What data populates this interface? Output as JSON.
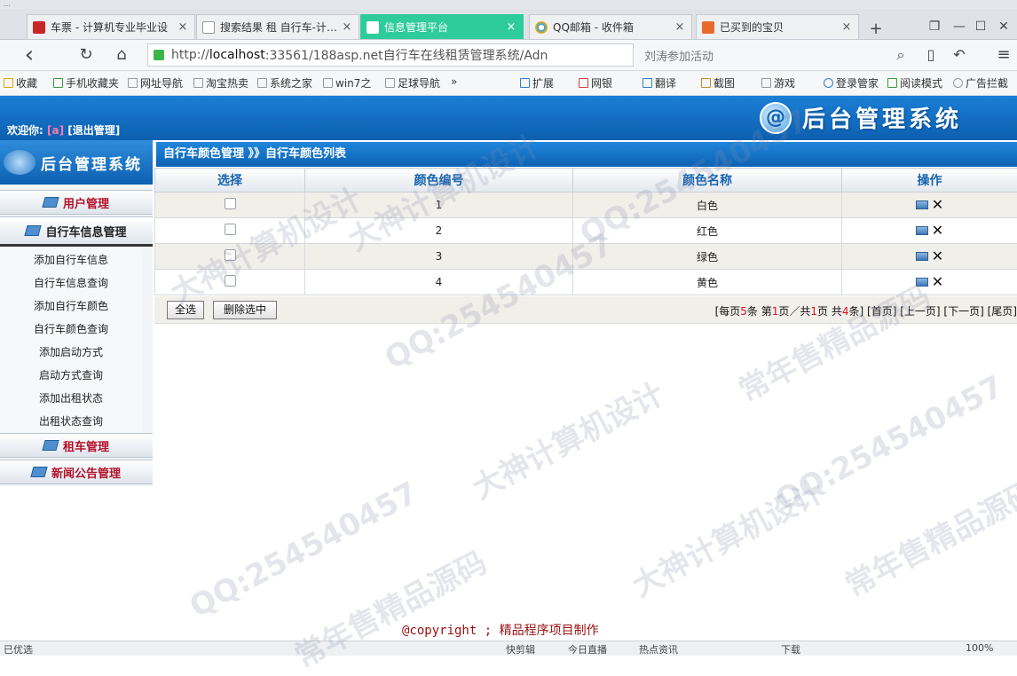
{
  "browser": {
    "top_strip_text": "…",
    "tabs": [
      {
        "label": "车票 - 计算机专业毕业设",
        "active": false,
        "icon_color": "#c62828"
      },
      {
        "label": "搜索结果 租 自行车-计…",
        "active": false,
        "icon_color": "#ffffff"
      },
      {
        "label": "信息管理平台",
        "active": true,
        "icon_color": "#ffffff"
      },
      {
        "label": "QQ邮箱 - 收件箱",
        "active": false,
        "icon_color": "#2e9cf0"
      },
      {
        "label": "已买到的宝贝",
        "active": false,
        "icon_color": "#e86a2a"
      }
    ],
    "tab_close": "×",
    "new_tab": "+",
    "window_controls": [
      "❐",
      "—",
      "☐",
      "✕"
    ],
    "nav": {
      "back": "‹",
      "refresh": "↻",
      "home": "⌂"
    },
    "url": {
      "prefix": "http://",
      "host": "localhost",
      "rest": ":33561/188asp.net自行车在线租赁管理系统/Adn"
    },
    "search_placeholder": "刘涛参加活动",
    "toolbar_right": [
      "⌕",
      "▯",
      "↶",
      "≡"
    ],
    "bookmarks": [
      "收藏",
      "手机收藏夹",
      "网址导航",
      "淘宝热卖",
      "系统之家",
      "win7之",
      "足球导航",
      "»",
      "扩展",
      "网银",
      "翻译",
      "截图",
      "游戏",
      "登录管家",
      "阅读模式",
      "广告拦截"
    ]
  },
  "header": {
    "welcome_label": "欢迎你:",
    "username": "[a]",
    "logout": "[退出管理]",
    "system_title": "后台管理系统",
    "logo_glyph": "@"
  },
  "sidebar": {
    "brand": "后台管理系统",
    "groups": [
      {
        "label": "用户管理"
      },
      {
        "label": "自行车信息管理"
      },
      {
        "label": "租车管理"
      },
      {
        "label": "新闻公告管理"
      }
    ],
    "items": [
      "添加自行车信息",
      "自行车信息查询",
      "添加自行车颜色",
      "自行车颜色查询",
      "添加启动方式",
      "启动方式查询",
      "添加出租状态",
      "出租状态查询"
    ]
  },
  "breadcrumb": "自行车颜色管理 》》自行车颜色列表",
  "table": {
    "headers": [
      "选择",
      "颜色编号",
      "颜色名称",
      "操作"
    ],
    "rows": [
      {
        "id": "1",
        "name": "白色"
      },
      {
        "id": "2",
        "name": "红色"
      },
      {
        "id": "3",
        "name": "绿色"
      },
      {
        "id": "4",
        "name": "黄色"
      }
    ],
    "delete_glyph": "✕"
  },
  "actions": {
    "select_all": "全选",
    "delete_selected": "删除选中"
  },
  "pager": {
    "per_page_pre": "[每页",
    "per_page": "5",
    "per_page_post": "条 第",
    "page": "1",
    "page_post": "页／共",
    "total_pages": "1",
    "total_pages_post": "页 共",
    "total": "4",
    "total_post": "条]",
    "first": "[首页]",
    "prev": "[上一页]",
    "next": "[下一页]",
    "last": "[尾页]"
  },
  "copyright": "@copyright ; 精品程序项目制作",
  "statusbar": [
    "已优选",
    "快剪辑",
    "今日直播",
    "热点资讯",
    "下载",
    "100%"
  ],
  "watermarks": [
    "QQ:254540457",
    "大神计算机设计",
    "常年售精品源码"
  ]
}
